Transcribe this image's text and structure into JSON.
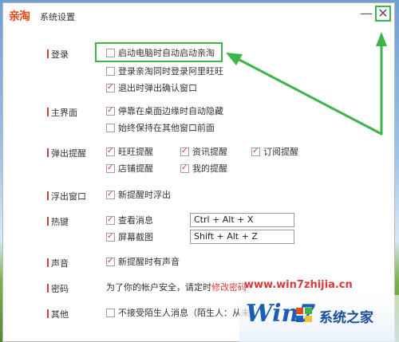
{
  "window": {
    "brand": "亲淘",
    "title": "系统设置",
    "minimize_label": "—",
    "close_label": "✕"
  },
  "sections": {
    "login": "登录",
    "main_ui": "主界面",
    "popup": "弹出提醒",
    "float": "浮出窗口",
    "hotkey": "热键",
    "sound": "声音",
    "password": "密码",
    "other": "其他"
  },
  "options": {
    "auto_start": {
      "label": "启动电脑时自动启动亲淘",
      "checked": false
    },
    "wangwang_login": {
      "label": "登录亲淘同时登录阿里旺旺",
      "checked": false
    },
    "exit_confirm": {
      "label": "退出时弹出确认窗口",
      "checked": true
    },
    "dock_hide": {
      "label": "停靠在桌面边缘时自动隐藏",
      "checked": true
    },
    "always_top": {
      "label": "始终保持在其他窗口前面",
      "checked": false
    },
    "wangwang_remind": {
      "label": "旺旺提醒",
      "checked": true
    },
    "news_remind": {
      "label": "资讯提醒",
      "checked": true
    },
    "subscribe_remind": {
      "label": "订阅提醒",
      "checked": true
    },
    "shop_remind": {
      "label": "店铺提醒",
      "checked": true
    },
    "my_remind": {
      "label": "我的提醒",
      "checked": true
    },
    "float_new": {
      "label": "新提醒时浮出",
      "checked": true
    },
    "view_msg": {
      "label": "查看消息",
      "checked": true
    },
    "screenshot": {
      "label": "屏幕截图",
      "checked": true
    },
    "sound_new": {
      "label": "新提醒时有声音",
      "checked": true
    },
    "no_stranger": {
      "label": "不接受陌生人消息（陌生人：从未",
      "checked": false
    }
  },
  "hotkeys": {
    "view_msg": "Ctrl + Alt + X",
    "screenshot": "Shift + Alt + Z"
  },
  "password": {
    "text": "为了你的帐户安全，请定时",
    "link": "修改密码"
  },
  "watermark": {
    "url": "www.win7zhijia.cn",
    "logo_text": "Win7",
    "site_name": "系统之家"
  },
  "colors": {
    "accent_red": "#d9393b",
    "highlight_green": "#3db54a",
    "brand_orange": "#e2491c"
  }
}
